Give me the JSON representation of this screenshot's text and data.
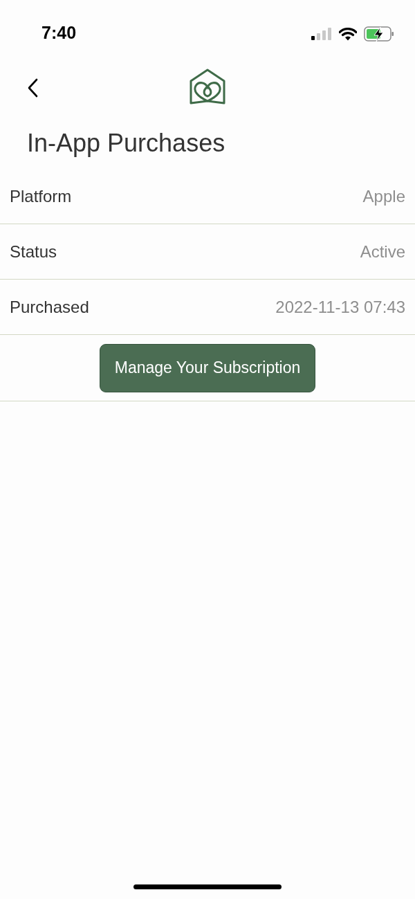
{
  "status_bar": {
    "time": "7:40"
  },
  "title": "In-App Purchases",
  "details": [
    {
      "label": "Platform",
      "value": "Apple"
    },
    {
      "label": "Status",
      "value": "Active"
    },
    {
      "label": "Purchased",
      "value": "2022-11-13 07:43"
    }
  ],
  "button": "Manage Your Subscription"
}
